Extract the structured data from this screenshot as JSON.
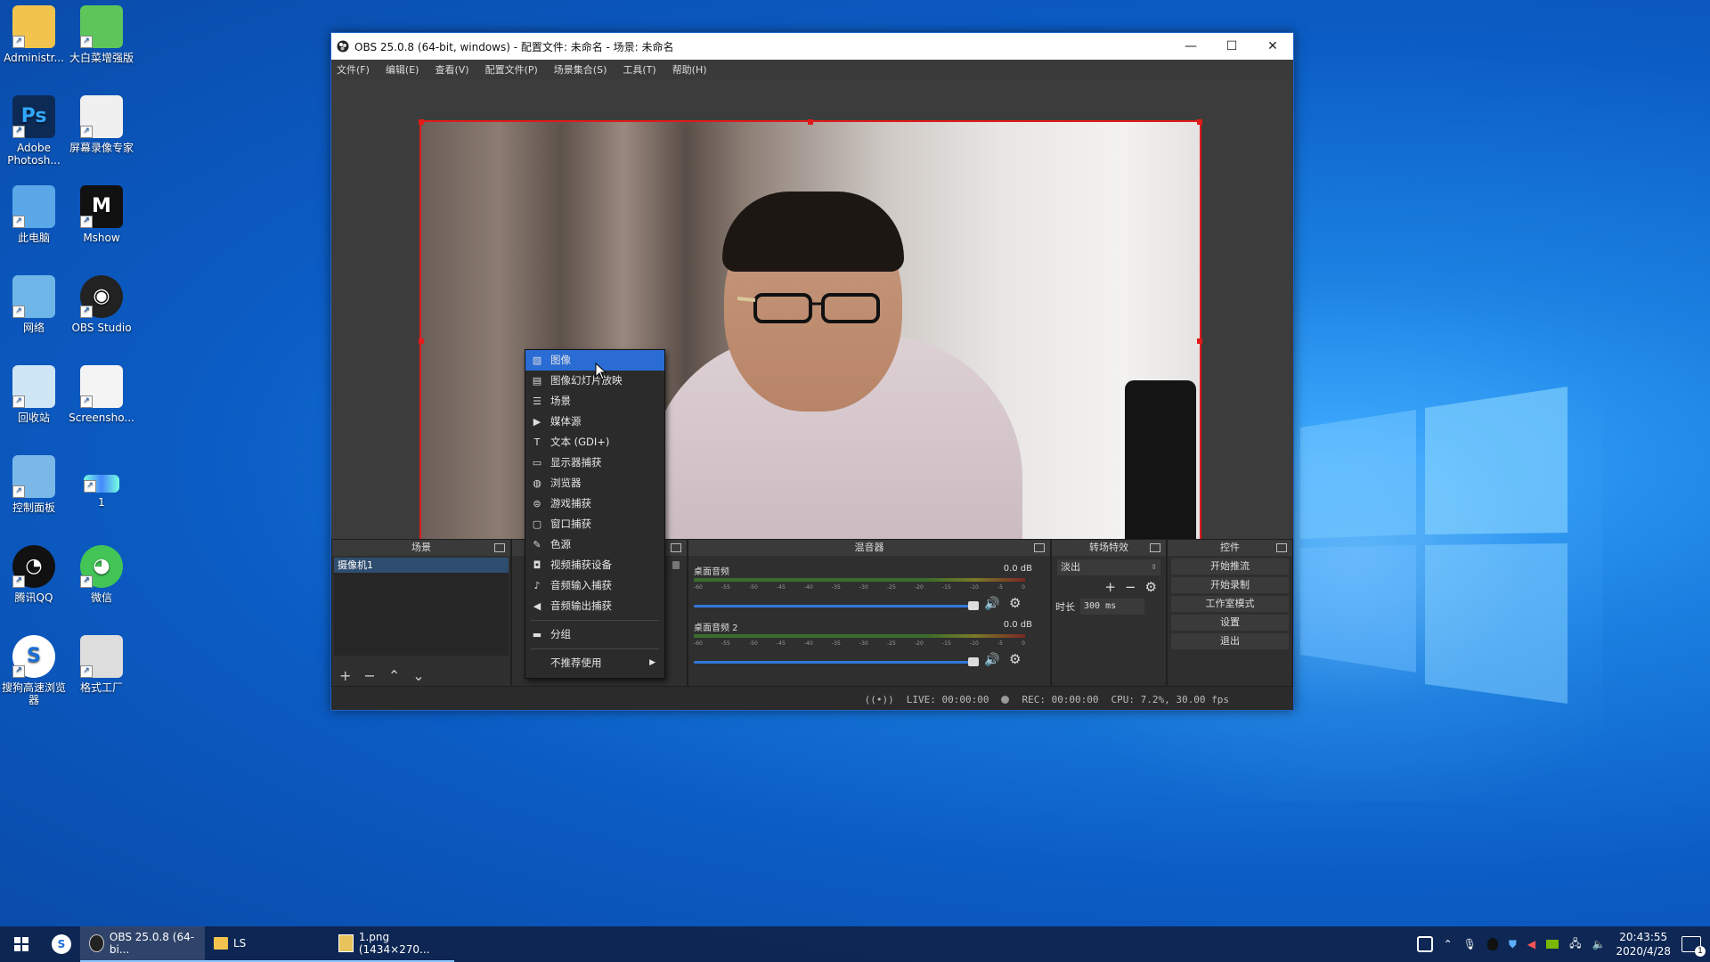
{
  "desktop": {
    "icons": [
      {
        "label": "Administr...",
        "icon": "user-folder-icon"
      },
      {
        "label": "大白菜增强版",
        "icon": "cabbage-app-icon"
      },
      {
        "label": "Adobe Photosh...",
        "icon": "photoshop-icon"
      },
      {
        "label": "屏幕录像专家",
        "icon": "screen-recorder-icon"
      },
      {
        "label": "此电脑",
        "icon": "computer-icon"
      },
      {
        "label": "Mshow",
        "icon": "mshow-icon"
      },
      {
        "label": "网络",
        "icon": "network-icon"
      },
      {
        "label": "OBS Studio",
        "icon": "obs-icon"
      },
      {
        "label": "回收站",
        "icon": "recycle-bin-icon"
      },
      {
        "label": "Screensho...",
        "icon": "screenshot-file-icon"
      },
      {
        "label": "控制面板",
        "icon": "control-panel-icon"
      },
      {
        "label": "1",
        "icon": "image-file-icon"
      },
      {
        "label": "腾讯QQ",
        "icon": "qq-icon"
      },
      {
        "label": "微信",
        "icon": "wechat-icon"
      },
      {
        "label": "搜狗高速浏览器",
        "icon": "sogou-browser-icon"
      },
      {
        "label": "格式工厂",
        "icon": "format-factory-icon"
      }
    ]
  },
  "obs": {
    "title": "OBS 25.0.8 (64-bit, windows) - 配置文件: 未命名 - 场景: 未命名",
    "menu": [
      "文件(F)",
      "编辑(E)",
      "查看(V)",
      "配置文件(P)",
      "场景集合(S)",
      "工具(T)",
      "帮助(H)"
    ],
    "docks": {
      "scenes": {
        "title": "场景",
        "items": [
          "摄像机1"
        ]
      },
      "mixer": {
        "title": "混音器",
        "tracks": [
          {
            "name": "桌面音频",
            "db": "0.0 dB"
          },
          {
            "name": "桌面音频 2",
            "db": "0.0 dB"
          }
        ],
        "ticks": [
          "-60",
          "-55",
          "-50",
          "-45",
          "-40",
          "-35",
          "-30",
          "-25",
          "-20",
          "-15",
          "-10",
          "-5",
          "0"
        ]
      },
      "transitions": {
        "title": "转场特效",
        "selected": "淡出",
        "duration_label": "时长",
        "duration_value": "300 ms"
      },
      "controls": {
        "title": "控件",
        "buttons": [
          "开始推流",
          "开始录制",
          "工作室模式",
          "设置",
          "退出"
        ]
      }
    },
    "status": {
      "live": "LIVE: 00:00:00",
      "rec": "REC: 00:00:00",
      "cpu": "CPU: 7.2%, 30.00 fps"
    },
    "context_menu": {
      "items": [
        {
          "label": "图像",
          "icon": "image-icon",
          "selected": true
        },
        {
          "label": "图像幻灯片放映",
          "icon": "slideshow-icon"
        },
        {
          "label": "场景",
          "icon": "scene-list-icon"
        },
        {
          "label": "媒体源",
          "icon": "play-icon"
        },
        {
          "label": "文本 (GDI+)",
          "icon": "text-icon"
        },
        {
          "label": "显示器捕获",
          "icon": "monitor-icon"
        },
        {
          "label": "浏览器",
          "icon": "globe-icon"
        },
        {
          "label": "游戏捕获",
          "icon": "gamepad-icon"
        },
        {
          "label": "窗口捕获",
          "icon": "window-icon"
        },
        {
          "label": "色源",
          "icon": "brush-icon"
        },
        {
          "label": "视频捕获设备",
          "icon": "camera-icon"
        },
        {
          "label": "音频输入捕获",
          "icon": "microphone-icon"
        },
        {
          "label": "音频输出捕获",
          "icon": "speaker-icon"
        },
        {
          "label": "分组",
          "icon": "folder-icon"
        },
        {
          "label": "不推荐使用",
          "icon": "",
          "submenu": true
        }
      ]
    }
  },
  "taskbar": {
    "apps": [
      {
        "label": "OBS 25.0.8 (64-bi...",
        "icon": "obs-icon",
        "active": true
      },
      {
        "label": "LS",
        "icon": "folder-icon",
        "active": false
      },
      {
        "label": "1.png (1434×270...",
        "icon": "image-viewer-icon",
        "active": false
      }
    ],
    "time": "20:43:55",
    "date": "2020/4/28",
    "notification_count": "1"
  }
}
